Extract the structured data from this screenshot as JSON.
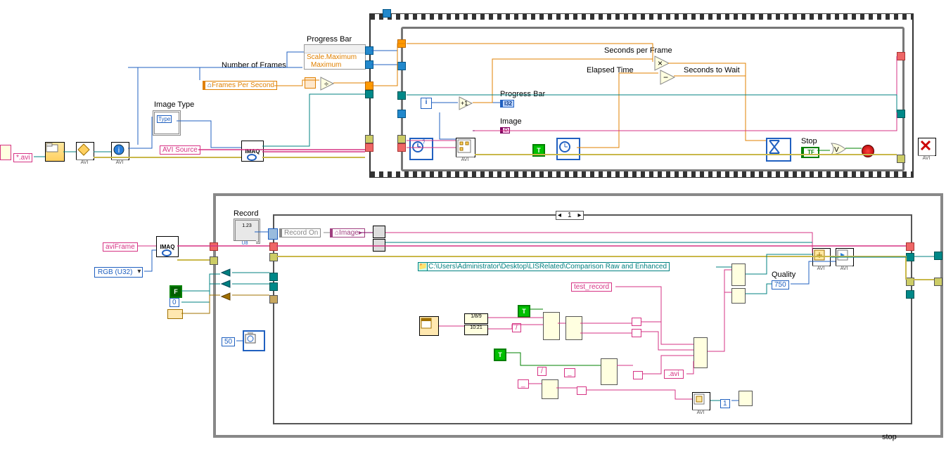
{
  "top": {
    "avi_ext": "*.avi",
    "image_type": "Image Type",
    "avi_source": "AVI Source",
    "frames_per_second": "Frames Per Second",
    "number_of_frames": "Number of Frames",
    "progress_bar_static": "Progress Bar",
    "scale_max": "Scale.Maximum",
    "maximum": "Maximum",
    "seconds_per_frame": "Seconds per Frame",
    "elapsed_time": "Elapsed Time",
    "seconds_to_wait": "Seconds to Wait",
    "progress_bar_dyn": "Progress Bar",
    "image_ind": "Image",
    "stop": "Stop",
    "imaq_label": "IMAQ",
    "avi_short": "AVI",
    "type_glyph": "Type",
    "i32": "I32",
    "img_d": "D",
    "tf": "TF",
    "i_term": "i"
  },
  "bottom": {
    "record": "Record",
    "record_on": "Record On",
    "aviFrame": "aviFrame",
    "rgb": "RGB (U32)",
    "image_local": "Image",
    "path": "C:\\Users\\Administrator\\Desktop\\LISRelated\\Comparison Raw and Enhanced",
    "test_record": "test_record",
    "avi_ext2": ".avi",
    "quality": "Quality",
    "quality_val": "750",
    "frame_sel": "1",
    "wait_ms": "50",
    "const0": "0",
    "const1": "1",
    "stop2": "stop",
    "imaq_label": "IMAQ",
    "avi_short": "AVI",
    "divider": "/",
    "sep": "_",
    "time1": "1/8/9",
    "time2": "10:21"
  }
}
